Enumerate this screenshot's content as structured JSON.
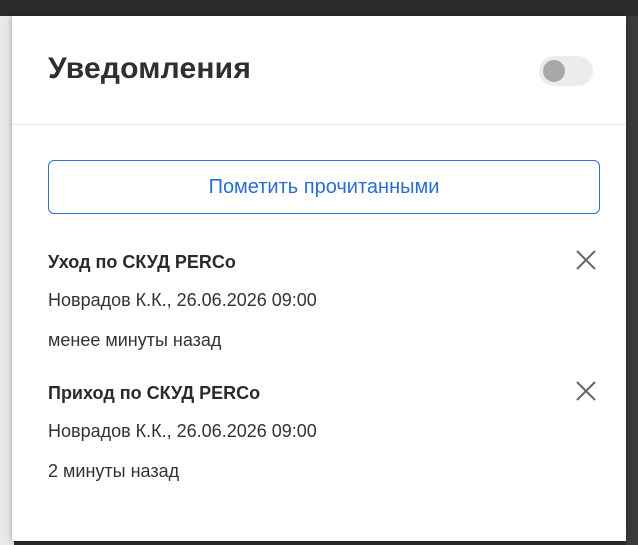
{
  "panel": {
    "title": "Уведомления",
    "toggle_on": false,
    "mark_read_label": "Пометить прочитанными"
  },
  "notifications": [
    {
      "title": "Уход по СКУД PERCo",
      "detail": "Новрадов К.К., 26.06.2026 09:00",
      "time": "менее минуты назад"
    },
    {
      "title": "Приход по СКУД PERCo",
      "detail": "Новрадов К.К., 26.06.2026 09:00",
      "time": "2 минуты назад"
    }
  ],
  "icons": {
    "close": "close-icon"
  },
  "colors": {
    "accent": "#2f76d2",
    "toggle_track": "#ececec",
    "toggle_knob": "#a8a8a8"
  }
}
